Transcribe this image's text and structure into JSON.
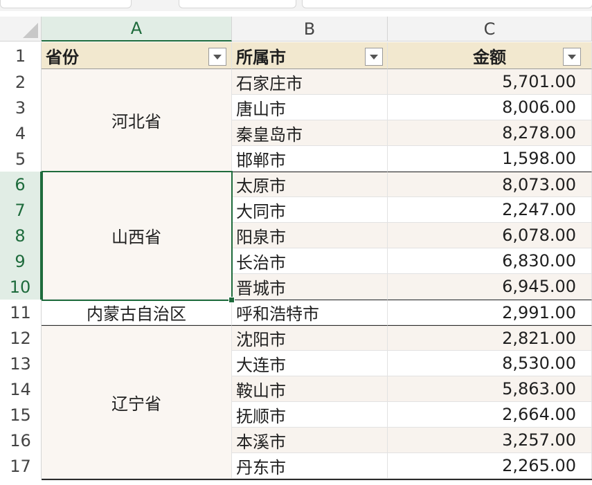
{
  "columns": [
    "A",
    "B",
    "C"
  ],
  "selected_column": "A",
  "selected_rows": [
    6,
    7,
    8,
    9,
    10
  ],
  "row_numbers": [
    "1",
    "2",
    "3",
    "4",
    "5",
    "6",
    "7",
    "8",
    "9",
    "10",
    "11",
    "12",
    "13",
    "14",
    "15",
    "16",
    "17"
  ],
  "headers": {
    "province": "省份",
    "city": "所属市",
    "amount": "金额"
  },
  "provinces": [
    "河北省",
    "山西省",
    "内蒙古自治区",
    "辽宁省"
  ],
  "rows": [
    {
      "city": "石家庄市",
      "amount": "5,701.00"
    },
    {
      "city": "唐山市",
      "amount": "8,006.00"
    },
    {
      "city": "秦皇岛市",
      "amount": "8,278.00"
    },
    {
      "city": "邯郸市",
      "amount": "1,598.00"
    },
    {
      "city": "太原市",
      "amount": "8,073.00"
    },
    {
      "city": "大同市",
      "amount": "2,247.00"
    },
    {
      "city": "阳泉市",
      "amount": "6,078.00"
    },
    {
      "city": "长治市",
      "amount": "6,830.00"
    },
    {
      "city": "晋城市",
      "amount": "6,945.00"
    },
    {
      "city": "呼和浩特市",
      "amount": "2,991.00"
    },
    {
      "city": "沈阳市",
      "amount": "2,821.00"
    },
    {
      "city": "大连市",
      "amount": "8,530.00"
    },
    {
      "city": "鞍山市",
      "amount": "5,863.00"
    },
    {
      "city": "抚顺市",
      "amount": "2,664.00"
    },
    {
      "city": "本溪市",
      "amount": "3,257.00"
    },
    {
      "city": "丹东市",
      "amount": "2,265.00"
    }
  ],
  "colors": {
    "header_fill": "#f2e8cf",
    "band_fill": "#f8f3ee",
    "selection": "#1e6b3c"
  }
}
